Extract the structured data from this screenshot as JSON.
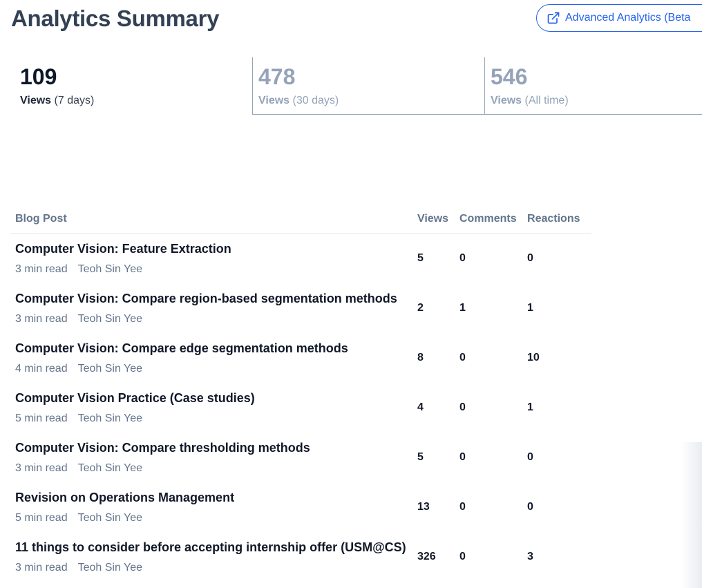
{
  "header": {
    "title": "Analytics Summary",
    "advanced_button_label": "Advanced Analytics (Beta",
    "advanced_button_icon": "external-link-icon"
  },
  "stats": [
    {
      "value": "109",
      "label": "Views",
      "period": "(7 days)"
    },
    {
      "value": "478",
      "label": "Views",
      "period": "(30 days)"
    },
    {
      "value": "546",
      "label": "Views",
      "period": "(All time)"
    }
  ],
  "table": {
    "headers": {
      "post": "Blog Post",
      "views": "Views",
      "comments": "Comments",
      "reactions": "Reactions"
    },
    "rows": [
      {
        "title": "Computer Vision: Feature Extraction",
        "read_time": "3 min read",
        "author": "Teoh Sin Yee",
        "views": "5",
        "comments": "0",
        "reactions": "0"
      },
      {
        "title": "Computer Vision: Compare region-based segmentation methods",
        "read_time": "3 min read",
        "author": "Teoh Sin Yee",
        "views": "2",
        "comments": "1",
        "reactions": "1"
      },
      {
        "title": "Computer Vision: Compare edge segmentation methods",
        "read_time": "4 min read",
        "author": "Teoh Sin Yee",
        "views": "8",
        "comments": "0",
        "reactions": "10"
      },
      {
        "title": "Computer Vision Practice (Case studies)",
        "read_time": "5 min read",
        "author": "Teoh Sin Yee",
        "views": "4",
        "comments": "0",
        "reactions": "1"
      },
      {
        "title": "Computer Vision: Compare thresholding methods",
        "read_time": "3 min read",
        "author": "Teoh Sin Yee",
        "views": "5",
        "comments": "0",
        "reactions": "0"
      },
      {
        "title": "Revision on Operations Management",
        "read_time": "5 min read",
        "author": "Teoh Sin Yee",
        "views": "13",
        "comments": "0",
        "reactions": "0"
      },
      {
        "title": "11 things to consider before accepting internship offer (USM@CS)",
        "read_time": "3 min read",
        "author": "Teoh Sin Yee",
        "views": "326",
        "comments": "0",
        "reactions": "3"
      }
    ]
  },
  "colors": {
    "accent": "#2563eb",
    "title": "#334155",
    "muted": "#94a3b8",
    "header_text": "#64748b"
  }
}
